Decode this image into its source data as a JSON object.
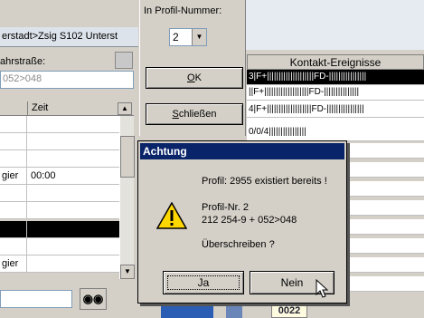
{
  "left_panel": {
    "title": "erstadt>Zsig S102 Unterst",
    "field_label": "ahrstraße:",
    "field_value": "052>048",
    "grid_header_col2": "Zeit",
    "rows": [
      {
        "c1": "",
        "c2": ""
      },
      {
        "c1": "",
        "c2": ""
      },
      {
        "c1": "",
        "c2": ""
      },
      {
        "c1": "gier",
        "c2": "00:00"
      },
      {
        "c1": "",
        "c2": ""
      },
      {
        "c1": "",
        "c2": ""
      },
      {
        "c1": "",
        "c2": ""
      },
      {
        "c1": "",
        "c2": ""
      },
      {
        "c1": "gier",
        "c2": ""
      }
    ]
  },
  "profile_panel": {
    "label": "In Profil-Nummer:",
    "selected_number": "2",
    "ok_label": "OK",
    "close_label": "Schließen"
  },
  "kontakt": {
    "header": "Kontakt-Ereignisse",
    "rows": [
      "3|F+||||||||||||||||||||FD-||||||||||||||||",
      "||F+|||||||||||||||||||FD-|||||||||||||||",
      "4|F+|||||||||||||||||||FD-||||||||||||||||",
      "0/0/4||||||||||||||||"
    ],
    "code": "0022"
  },
  "dialog": {
    "title": "Achtung",
    "message": "Profil: 2955 existiert bereits !",
    "profile_nr": "Profil-Nr. 2",
    "detail": "212 254-9 + 052>048",
    "question": "Überschreiben ?",
    "yes_label": "Ja",
    "no_label": "Nein"
  },
  "colors": {
    "title_bar": "#0a246a",
    "warning_yellow": "#ffd700",
    "window_bg": "#d4d0c8"
  },
  "icons": {
    "warning": "warning-icon",
    "search": "binoculars-icon",
    "cursor": "mouse-pointer-icon"
  }
}
